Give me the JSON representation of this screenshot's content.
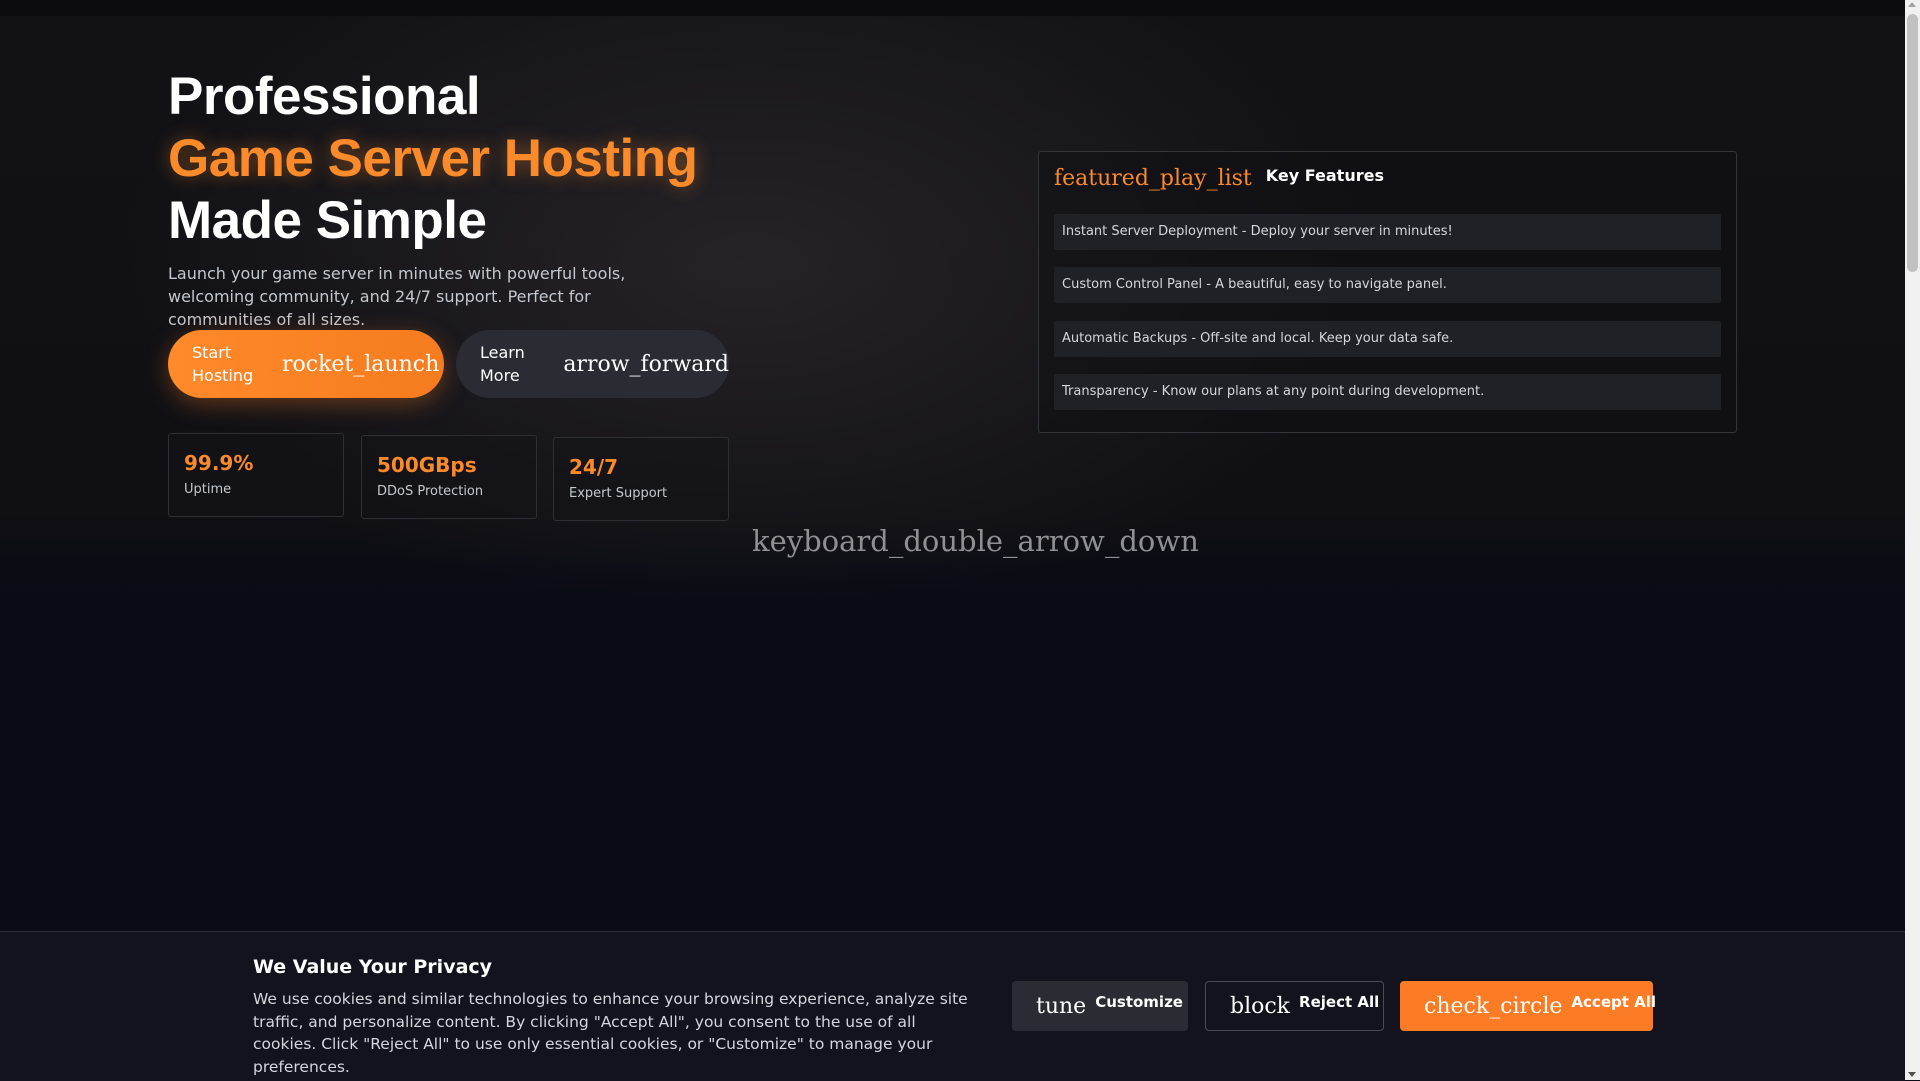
{
  "hero": {
    "headline_line1": "Professional",
    "headline_accent": "Game Server Hosting",
    "headline_line3": "Made Simple",
    "subtitle": "Launch your game server in minutes with powerful tools, welcoming community, and 24/7 support. Perfect for communities of all sizes.",
    "primary_button": {
      "label": "Start Hosting",
      "icon": "rocket_launch"
    },
    "secondary_button": {
      "label": "Learn More",
      "icon": "arrow_forward"
    },
    "stats": [
      {
        "value": "99.9%",
        "label": "Uptime"
      },
      {
        "value": "500GBps",
        "label": "DDoS Protection"
      },
      {
        "value": "24/7",
        "label": "Expert Support"
      }
    ],
    "scroll_hint_icon": "keyboard_double_arrow_down"
  },
  "features": {
    "icon": "featured_play_list",
    "title": "Key Features",
    "items": [
      "Instant Server Deployment - Deploy your server in minutes!",
      "Custom Control Panel - A beautiful, easy to navigate panel.",
      "Automatic Backups - Off-site and local. Keep your data safe.",
      "Transparency - Know our plans at any point during development."
    ]
  },
  "cookie_banner": {
    "title": "We Value Your Privacy",
    "text": "We use cookies and similar technologies to enhance your browsing experience, analyze site traffic, and personalize content. By clicking \"Accept All\", you consent to the use of all cookies. Click \"Reject All\" to use only essential cookies, or \"Customize\" to manage your preferences.",
    "customize": {
      "icon": "tune",
      "label": "Customize"
    },
    "reject": {
      "icon": "block",
      "label": "Reject All"
    },
    "accept": {
      "icon": "check_circle",
      "label": "Accept All"
    }
  },
  "colors": {
    "accent": "#fb8a2a",
    "background": "#0a0b14",
    "panel": "#202126"
  }
}
